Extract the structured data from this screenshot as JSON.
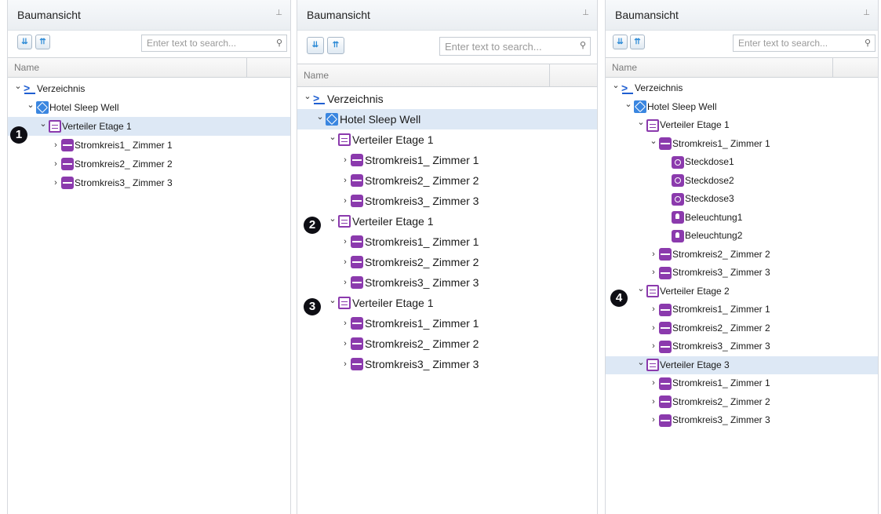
{
  "panel_common": {
    "title": "Baumansicht",
    "search_placeholder": "Enter text to search...",
    "column_name": "Name"
  },
  "markers": [
    "1",
    "2",
    "3",
    "4"
  ],
  "panel1": {
    "tree": [
      {
        "label": "Verzeichnis",
        "icon": "verzeichnis-icon",
        "chevron": "expanded"
      },
      {
        "label": "Hotel Sleep Well",
        "icon": "building-icon",
        "chevron": "expanded"
      },
      {
        "label": "Verteiler Etage 1",
        "icon": "verteiler-icon",
        "chevron": "expanded",
        "selected": true
      },
      {
        "label": "Stromkreis1_ Zimmer 1",
        "icon": "stromkreis-icon",
        "chevron": "collapsed"
      },
      {
        "label": "Stromkreis2_ Zimmer 2",
        "icon": "stromkreis-icon",
        "chevron": "collapsed"
      },
      {
        "label": "Stromkreis3_ Zimmer 3",
        "icon": "stromkreis-icon",
        "chevron": "collapsed"
      }
    ]
  },
  "panel2": {
    "tree": [
      {
        "label": "Verzeichnis",
        "icon": "verzeichnis-icon",
        "chevron": "expanded"
      },
      {
        "label": "Hotel Sleep Well",
        "icon": "building-icon",
        "chevron": "expanded",
        "selected": true
      },
      {
        "label": "Verteiler Etage 1",
        "icon": "verteiler-icon",
        "chevron": "expanded"
      },
      {
        "label": "Stromkreis1_ Zimmer 1",
        "icon": "stromkreis-icon",
        "chevron": "collapsed"
      },
      {
        "label": "Stromkreis2_ Zimmer 2",
        "icon": "stromkreis-icon",
        "chevron": "collapsed"
      },
      {
        "label": "Stromkreis3_ Zimmer 3",
        "icon": "stromkreis-icon",
        "chevron": "collapsed"
      },
      {
        "label": "Verteiler Etage 1",
        "icon": "verteiler-icon",
        "chevron": "expanded"
      },
      {
        "label": "Stromkreis1_ Zimmer 1",
        "icon": "stromkreis-icon",
        "chevron": "collapsed"
      },
      {
        "label": "Stromkreis2_ Zimmer 2",
        "icon": "stromkreis-icon",
        "chevron": "collapsed"
      },
      {
        "label": "Stromkreis3_ Zimmer 3",
        "icon": "stromkreis-icon",
        "chevron": "collapsed"
      },
      {
        "label": "Verteiler Etage 1",
        "icon": "verteiler-icon",
        "chevron": "expanded"
      },
      {
        "label": "Stromkreis1_ Zimmer 1",
        "icon": "stromkreis-icon",
        "chevron": "collapsed"
      },
      {
        "label": "Stromkreis2_ Zimmer 2",
        "icon": "stromkreis-icon",
        "chevron": "collapsed"
      },
      {
        "label": "Stromkreis3_ Zimmer 3",
        "icon": "stromkreis-icon",
        "chevron": "collapsed"
      }
    ]
  },
  "panel3": {
    "tree": [
      {
        "label": "Verzeichnis",
        "icon": "verzeichnis-icon",
        "chevron": "expanded"
      },
      {
        "label": "Hotel Sleep Well",
        "icon": "building-icon",
        "chevron": "expanded"
      },
      {
        "label": "Verteiler Etage 1",
        "icon": "verteiler-icon",
        "chevron": "expanded"
      },
      {
        "label": "Stromkreis1_ Zimmer 1",
        "icon": "stromkreis-icon",
        "chevron": "expanded"
      },
      {
        "label": "Steckdose1",
        "icon": "steckdose-icon",
        "chevron": "none"
      },
      {
        "label": "Steckdose2",
        "icon": "steckdose-icon",
        "chevron": "none"
      },
      {
        "label": "Steckdose3",
        "icon": "steckdose-icon",
        "chevron": "none"
      },
      {
        "label": "Beleuchtung1",
        "icon": "beleuchtung-icon",
        "chevron": "none"
      },
      {
        "label": "Beleuchtung2",
        "icon": "beleuchtung-icon",
        "chevron": "none"
      },
      {
        "label": "Stromkreis2_ Zimmer 2",
        "icon": "stromkreis-icon",
        "chevron": "collapsed"
      },
      {
        "label": "Stromkreis3_ Zimmer 3",
        "icon": "stromkreis-icon",
        "chevron": "collapsed"
      },
      {
        "label": "Verteiler Etage 2",
        "icon": "verteiler-icon",
        "chevron": "expanded"
      },
      {
        "label": "Stromkreis1_ Zimmer 1",
        "icon": "stromkreis-icon",
        "chevron": "collapsed"
      },
      {
        "label": "Stromkreis2_ Zimmer 2",
        "icon": "stromkreis-icon",
        "chevron": "collapsed"
      },
      {
        "label": "Stromkreis3_ Zimmer 3",
        "icon": "stromkreis-icon",
        "chevron": "collapsed"
      },
      {
        "label": "Verteiler Etage 3",
        "icon": "verteiler-icon",
        "chevron": "expanded",
        "selected": true
      },
      {
        "label": "Stromkreis1_ Zimmer 1",
        "icon": "stromkreis-icon",
        "chevron": "collapsed"
      },
      {
        "label": "Stromkreis2_ Zimmer 2",
        "icon": "stromkreis-icon",
        "chevron": "collapsed"
      },
      {
        "label": "Stromkreis3_ Zimmer 3",
        "icon": "stromkreis-icon",
        "chevron": "collapsed"
      }
    ]
  }
}
